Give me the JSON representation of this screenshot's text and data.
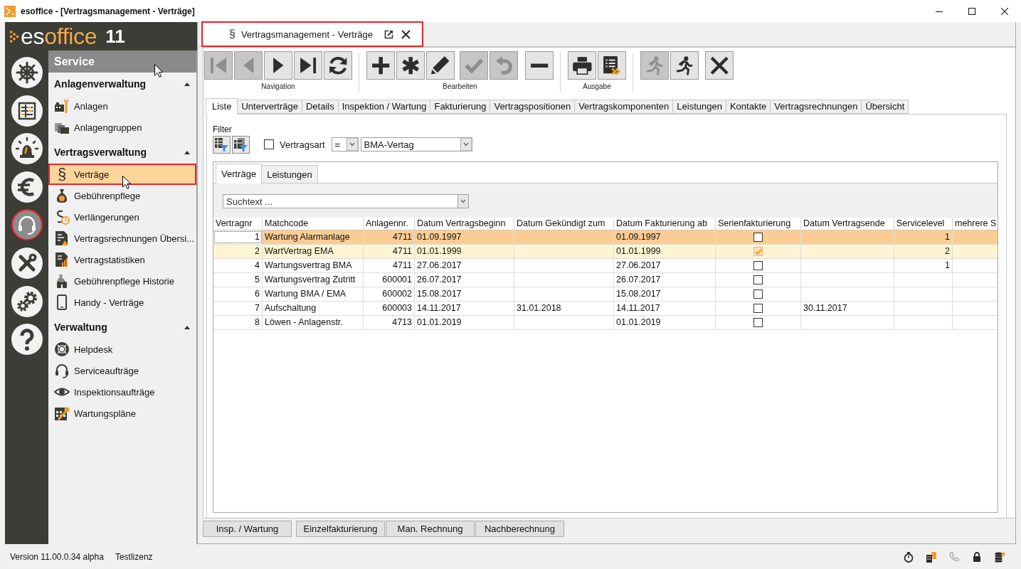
{
  "window": {
    "title": "esoffice - [Vertragsmanagement - Verträge]"
  },
  "logo": {
    "brand_start": "es",
    "brand_end": "office",
    "version": "11"
  },
  "nav_rail": [
    {
      "selected": false
    },
    {
      "selected": false
    },
    {
      "selected": false
    },
    {
      "selected": false
    },
    {
      "selected": true
    },
    {
      "selected": false
    },
    {
      "selected": false
    },
    {
      "selected": false
    }
  ],
  "sidebar": {
    "header": "Service",
    "groups": [
      {
        "title": "Anlagenverwaltung",
        "expanded": true,
        "items": [
          {
            "label": "Anlagen",
            "selected": false
          },
          {
            "label": "Anlagengruppen",
            "selected": false
          }
        ]
      },
      {
        "title": "Vertragsverwaltung",
        "expanded": true,
        "items": [
          {
            "label": "Verträge",
            "selected": true,
            "glyph": "§"
          },
          {
            "label": "Gebührenpflege",
            "selected": false
          },
          {
            "label": "Verlängerungen",
            "selected": false
          },
          {
            "label": "Vertragsrechnungen Übersi...",
            "selected": false
          },
          {
            "label": "Vertragstatistiken",
            "selected": false
          },
          {
            "label": "Gebührenpflege Historie",
            "selected": false
          },
          {
            "label": "Handy - Verträge",
            "selected": false
          }
        ]
      },
      {
        "title": "Verwaltung",
        "expanded": true,
        "items": [
          {
            "label": "Helpdesk",
            "selected": false
          },
          {
            "label": "Serviceaufträge",
            "selected": false
          },
          {
            "label": "Inspektionsaufträge",
            "selected": false
          },
          {
            "label": "Wartungspläne",
            "selected": false
          }
        ]
      }
    ]
  },
  "document_tab": {
    "glyph": "§",
    "title": "Vertragsmanagement - Verträge"
  },
  "toolbar": [
    {
      "label": "Navigation",
      "buttons": [
        {
          "disabled": true
        },
        {
          "disabled": true
        },
        {
          "disabled": false
        },
        {
          "disabled": false
        },
        {
          "disabled": false
        }
      ]
    },
    {
      "label": "Bearbeiten",
      "buttons": [
        {
          "disabled": false
        },
        {
          "disabled": false
        },
        {
          "disabled": false
        },
        {
          "disabled": true
        },
        {
          "disabled": true
        },
        {
          "disabled": false
        }
      ]
    },
    {
      "label": "Ausgabe",
      "buttons": [
        {
          "disabled": false
        },
        {
          "disabled": false
        }
      ]
    },
    {
      "buttons": [
        {
          "disabled": true
        },
        {
          "disabled": false
        },
        {
          "disabled": false
        }
      ]
    }
  ],
  "tabs": [
    {
      "label": "Liste",
      "selected": true
    },
    {
      "label": "Unterverträge",
      "selected": false
    },
    {
      "label": "Details",
      "selected": false
    },
    {
      "label": "Inspektion / Wartung",
      "selected": false
    },
    {
      "label": "Fakturierung",
      "selected": false
    },
    {
      "label": "Vertragspositionen",
      "selected": false
    },
    {
      "label": "Vertragskomponenten",
      "selected": false
    },
    {
      "label": "Leistungen",
      "selected": false
    },
    {
      "label": "Kontakte",
      "selected": false
    },
    {
      "label": "Vertragsrechnungen",
      "selected": false
    },
    {
      "label": "Übersicht",
      "selected": false
    }
  ],
  "filter": {
    "label": "Filter",
    "checked": false,
    "field": "Vertragsart",
    "operator": "=",
    "value": "BMA-Vertag"
  },
  "subtabs": [
    {
      "label": "Verträge",
      "selected": true
    },
    {
      "label": "Leistungen",
      "selected": false
    }
  ],
  "search": {
    "placeholder": "Suchtext ..."
  },
  "table": {
    "columns": [
      "Vertragnr",
      "Matchcode",
      "Anlagennr.",
      "Datum Vertragsbeginn",
      "Datum Gekündigt zum",
      "Datum Fakturierung ab",
      "Serienfakturierung",
      "Datum Vertragsende",
      "Servicelevel",
      "mehrere S"
    ],
    "rows": [
      {
        "vertragnr": "1",
        "matchcode": "Wartung Alarmanlage",
        "anlagennr": "4711",
        "datum_vertragsbeginn": "01.09.1997",
        "datum_fakturierung_ab": "01.09.1997",
        "serienfakturierung": false,
        "servicelevel": "1",
        "selected": true,
        "highlighted": false
      },
      {
        "vertragnr": "2",
        "matchcode": "WartVertrag EMA",
        "anlagennr": "4711",
        "datum_vertragsbeginn": "01.01.1999",
        "datum_fakturierung_ab": "01.01.1999",
        "serienfakturierung": true,
        "servicelevel": "2",
        "selected": false,
        "highlighted": true
      },
      {
        "vertragnr": "4",
        "matchcode": "Wartungsvertrag BMA",
        "anlagennr": "4711",
        "datum_vertragsbeginn": "27.06.2017",
        "datum_fakturierung_ab": "27.06.2017",
        "serienfakturierung": false,
        "servicelevel": "1",
        "selected": false,
        "highlighted": false
      },
      {
        "vertragnr": "5",
        "matchcode": "Wartungsvertrag Zutritt",
        "anlagennr": "600001",
        "datum_vertragsbeginn": "26.07.2017",
        "datum_fakturierung_ab": "26.07.2017",
        "serienfakturierung": false,
        "selected": false,
        "highlighted": false
      },
      {
        "vertragnr": "6",
        "matchcode": "Wartung BMA / EMA",
        "anlagennr": "600002",
        "datum_vertragsbeginn": "15.08.2017",
        "datum_fakturierung_ab": "15.08.2017",
        "serienfakturierung": false,
        "selected": false,
        "highlighted": false
      },
      {
        "vertragnr": "7",
        "matchcode": "Aufschaltung",
        "anlagennr": "600003",
        "datum_vertragsbeginn": "14.11.2017",
        "datum_gekuendigt_zum": "31.01.2018",
        "datum_fakturierung_ab": "14.11.2017",
        "serienfakturierung": false,
        "datum_vertragsende": "30.11.2017",
        "selected": false,
        "highlighted": false
      },
      {
        "vertragnr": "8",
        "matchcode": "Löwen - Anlagenstr.",
        "anlagennr": "4713",
        "datum_vertragsbeginn": "01.01.2019",
        "datum_fakturierung_ab": "01.01.2019",
        "serienfakturierung": false,
        "selected": false,
        "highlighted": false
      }
    ]
  },
  "action_buttons": [
    "Insp. / Wartung",
    "Einzelfakturierung",
    "Man. Rechnung",
    "Nachberechnung"
  ],
  "status_bar": {
    "version": "Version 11.00.0.34 alpha",
    "license": "Testlizenz",
    "icons": [
      {
        "active": true
      },
      {
        "active": true
      },
      {
        "active": false
      },
      {
        "active": true
      },
      {
        "active": true
      }
    ]
  }
}
